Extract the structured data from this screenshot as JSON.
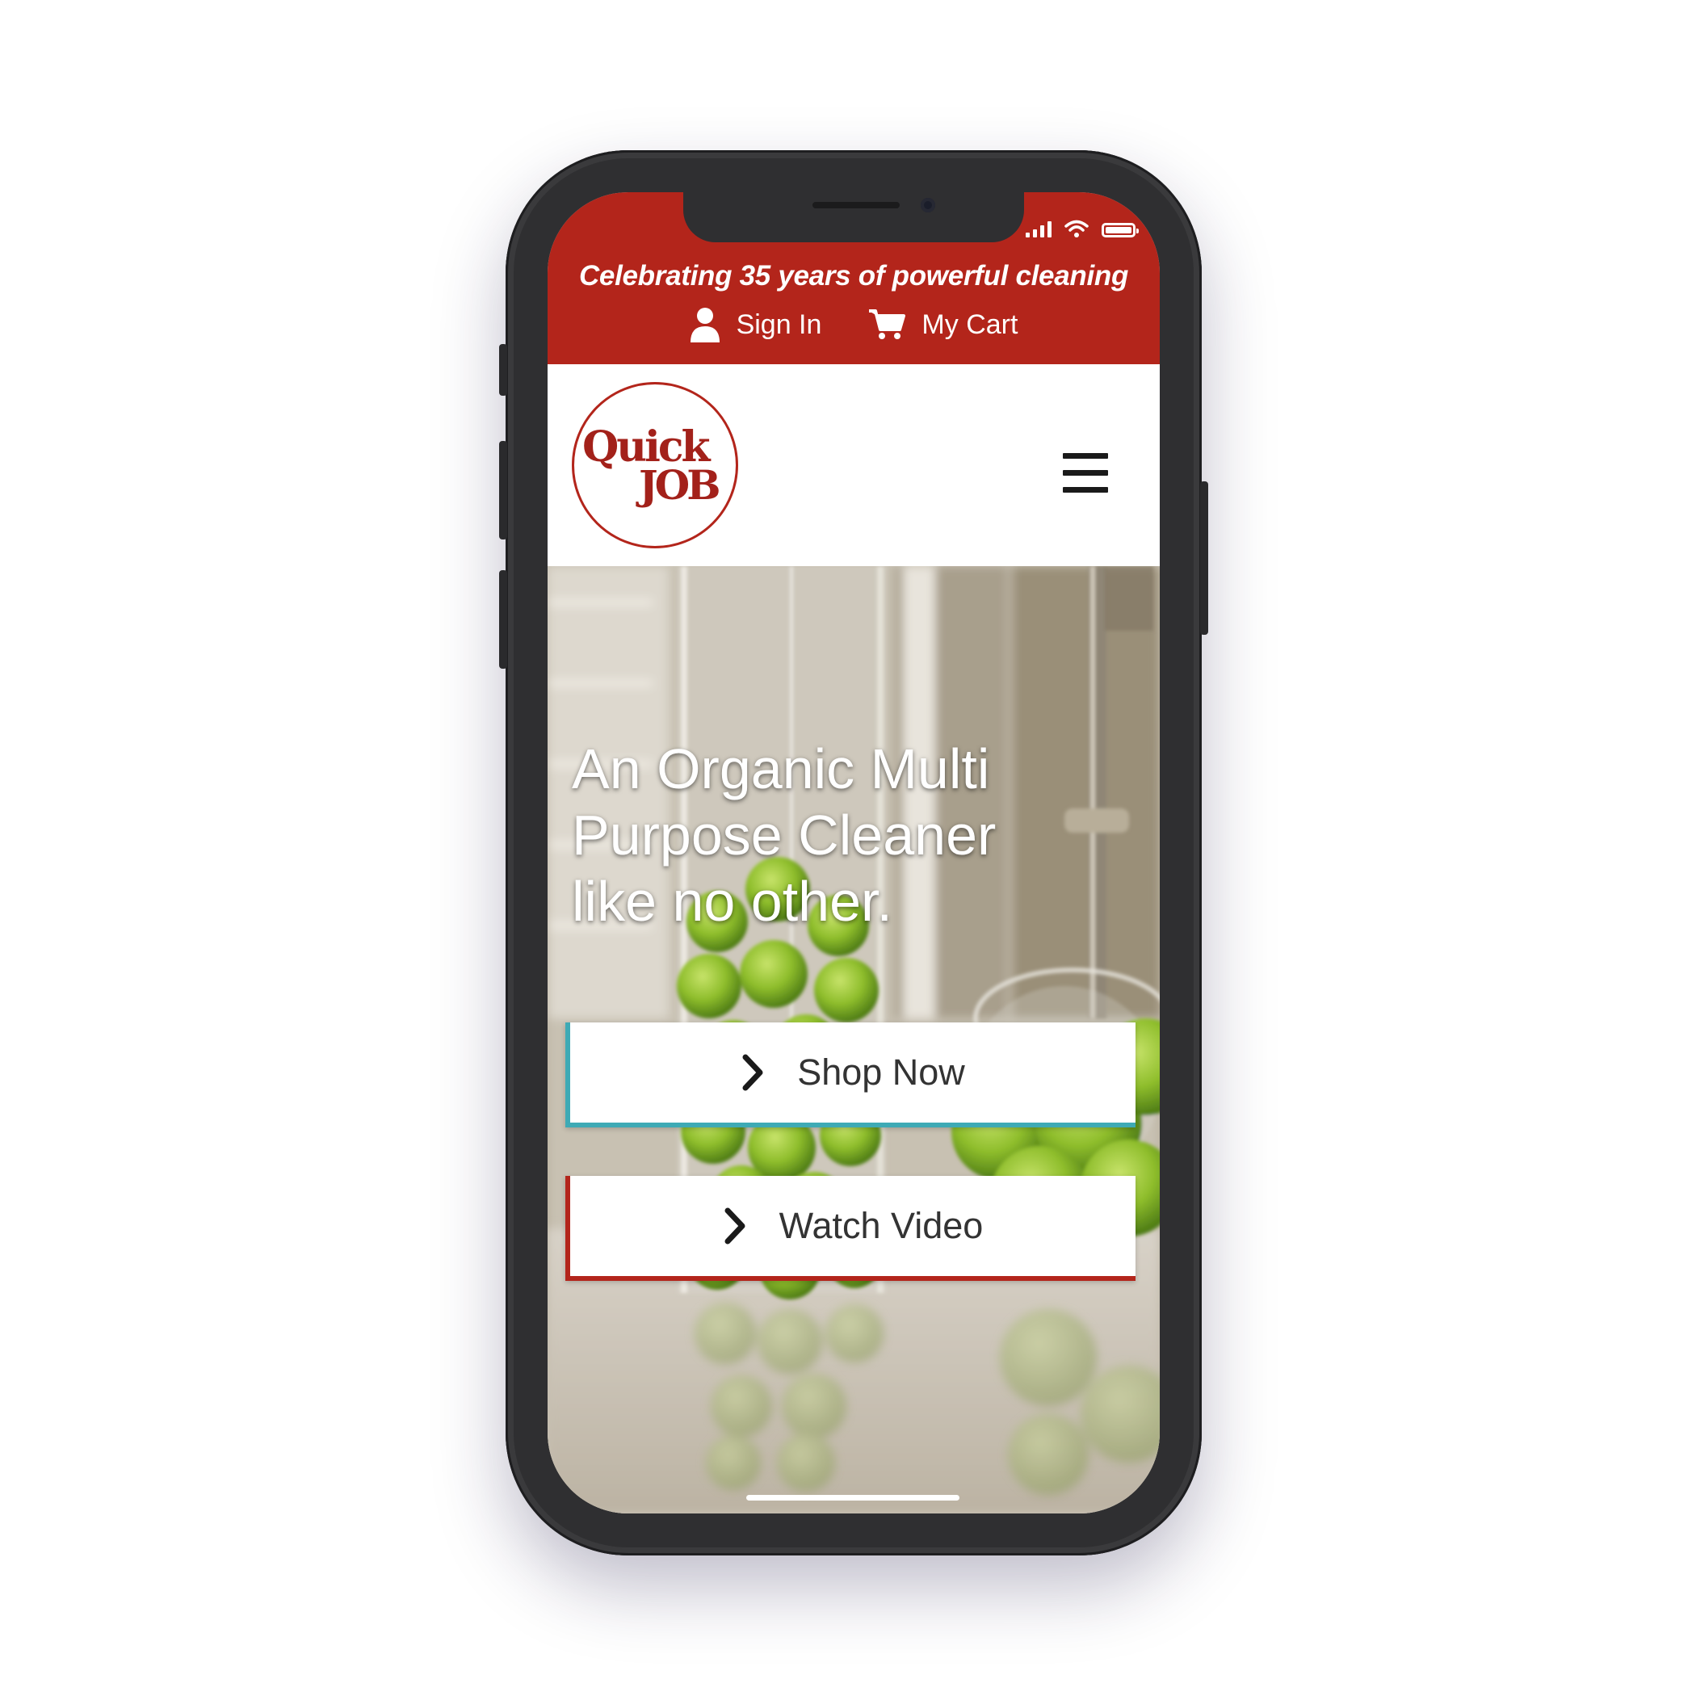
{
  "banner": {
    "tagline": "Celebrating 35 years of powerful cleaning",
    "sign_in_label": "Sign In",
    "cart_label": "My Cart",
    "background_color": "#b3251b",
    "text_color": "#ffffff"
  },
  "header": {
    "logo_line1": "Quick",
    "logo_line2": "JOB",
    "menu_icon": "hamburger-icon"
  },
  "hero": {
    "headline": "An Organic Multi Purpose Cleaner like no other.",
    "shop_now_label": "Shop Now",
    "watch_video_label": "Watch Video",
    "shop_accent_color": "#3eaab5",
    "video_accent_color": "#b3251b",
    "cta_icon": "chevron-right-icon"
  },
  "status_bar": {
    "icons": [
      "signal-icon",
      "wifi-icon",
      "battery-icon"
    ]
  }
}
